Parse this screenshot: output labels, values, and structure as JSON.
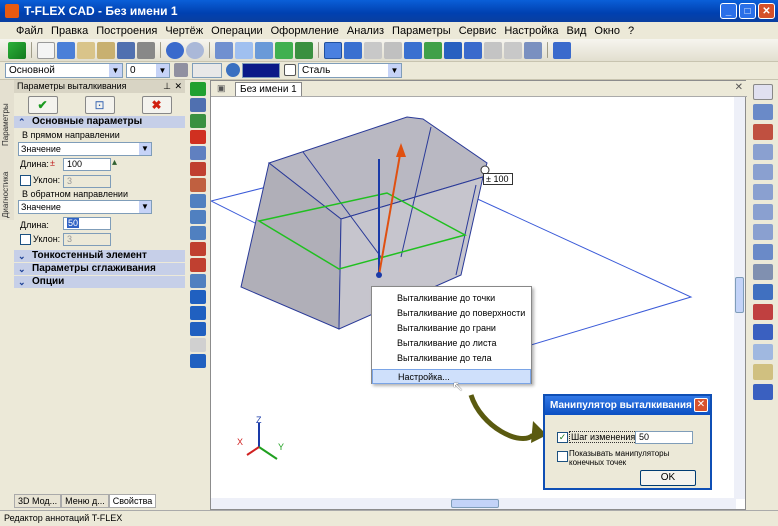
{
  "window": {
    "title": "T-FLEX CAD - Без имени 1",
    "min": "_",
    "max": "□",
    "close": "✕"
  },
  "menu": [
    "Файл",
    "Правка",
    "Построения",
    "Чертёж",
    "Операции",
    "Оформление",
    "Анализ",
    "Параметры",
    "Сервис",
    "Настройка",
    "Вид",
    "Окно",
    "?"
  ],
  "props_bar": {
    "layer": "Основной",
    "level": "0",
    "material": "Сталь"
  },
  "panel": {
    "title": "Параметры выталкивания",
    "vtab1": "Параметры",
    "vtab2": "Диагностика",
    "section_main": "Основные параметры",
    "forward_group": "В прямом направлении",
    "forward_mode": "Значение",
    "length_label": "Длина:",
    "forward_length": "100",
    "slope_label": "Уклон:",
    "forward_slope": "3",
    "backward_group": "В обратном направлении",
    "backward_mode": "Значение",
    "backward_length": "50",
    "backward_slope": "3",
    "section_thin": "Тонкостенный элемент",
    "section_smooth": "Параметры сглаживания",
    "section_options": "Опции"
  },
  "bottom_tabs": [
    "3D Мод...",
    "Меню д...",
    "Свойства"
  ],
  "doc_tab": "Без имени 1",
  "dimension_label": "100",
  "context_menu": {
    "items": [
      "Выталкивание до точки",
      "Выталкивание до поверхности",
      "Выталкивание до грани",
      "Выталкивание до листа",
      "Выталкивание до тела"
    ],
    "settings": "Настройка..."
  },
  "dialog": {
    "title": "Манипулятор выталкивания",
    "step_label": "Шаг изменения",
    "step_value": "50",
    "show_label_1": "Показывать манипуляторы",
    "show_label_2": "конечных точек",
    "ok": "OK"
  },
  "axes": {
    "x": "X",
    "y": "Y",
    "z": "Z"
  },
  "status": "Редактор аннотаций T-FLEX"
}
